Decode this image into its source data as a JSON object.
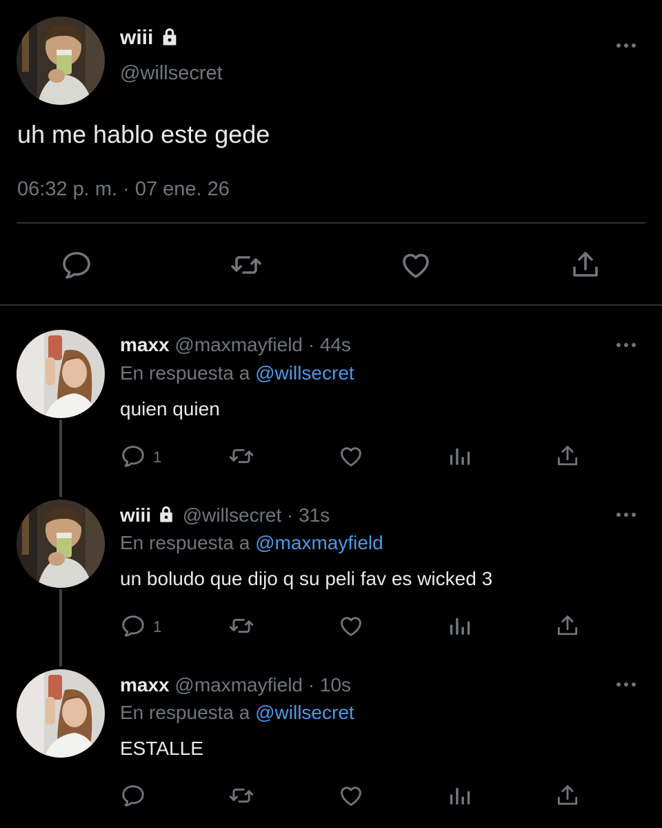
{
  "main_tweet": {
    "display_name": "wiii",
    "handle": "@willsecret",
    "text": "uh me hablo este gede",
    "timestamp": "06:32 p. m. · 07 ene. 26",
    "avatar_icon": "user-photo-avatar",
    "locked_icon": "lock-icon"
  },
  "replies": [
    {
      "display_name": "maxx",
      "handle": "@maxmayfield",
      "time": "· 44s",
      "reply_prefix": "En respuesta a",
      "reply_to": "@willsecret",
      "text": "quien quien",
      "reply_count": "1"
    },
    {
      "display_name": "wiii",
      "handle": "@willsecret",
      "time": "· 31s",
      "reply_prefix": "En respuesta a",
      "reply_to": "@maxmayfield",
      "text": "un boludo que dijo q su peli fav es wicked 3",
      "reply_count": "1"
    },
    {
      "display_name": "maxx",
      "handle": "@maxmayfield",
      "time": "· 10s",
      "reply_prefix": "En respuesta a",
      "reply_to": "@willsecret",
      "text": "ESTALLE",
      "reply_count": ""
    }
  ],
  "colors": {
    "background": "#000000",
    "text": "#e7e9ea",
    "muted": "#71767b",
    "link": "#4a99e9",
    "divider": "#2f3336"
  }
}
